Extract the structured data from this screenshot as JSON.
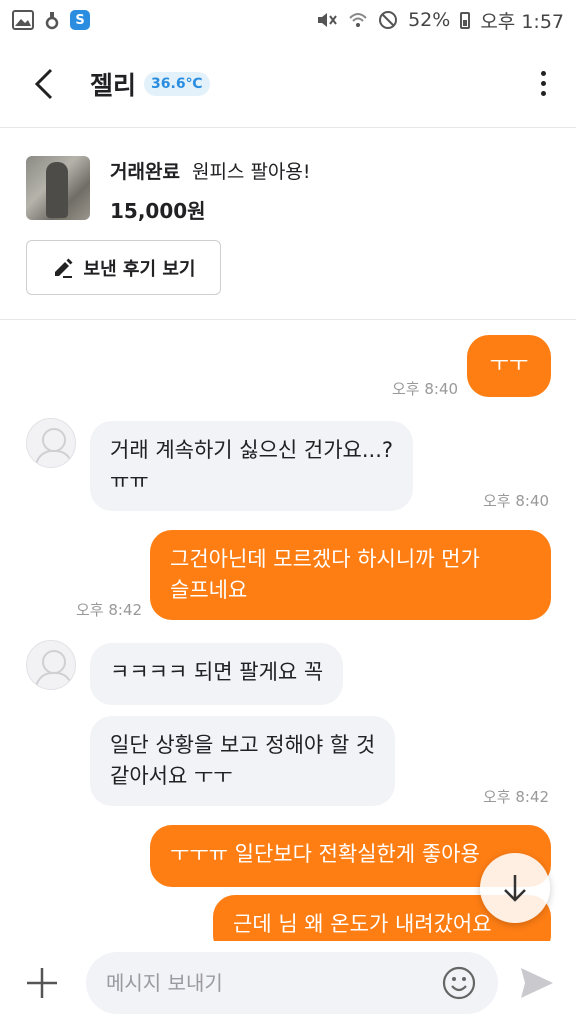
{
  "status_bar": {
    "left_icons": [
      "gallery-icon",
      "handshake-icon",
      "app-s-icon"
    ],
    "app_badge_letter": "S",
    "battery": "52%",
    "time": "오후 1:57"
  },
  "header": {
    "title": "젤리",
    "temperature": "36.6℃",
    "temperature_color": "#2a8de0"
  },
  "product": {
    "status": "거래완료",
    "title": "원피스 팔아용!",
    "price": "15,000원",
    "review_button": "보낸 후기 보기"
  },
  "messages": [
    {
      "sender": "me",
      "text": "ㅜㅜ"
    },
    {
      "sender": "me_time",
      "text": "오후 8:40"
    },
    {
      "sender": "them",
      "text_line1": "거래 계속하기 싫으신 건가요...?",
      "text_line2": "ㅠㅠ"
    },
    {
      "sender": "them_time",
      "text": "오후 8:40"
    },
    {
      "sender": "me",
      "text_line1": "그건아닌데 모르겠다 하시니까 먼가",
      "text_line2": "슬프네요"
    },
    {
      "sender": "me_time",
      "text": "오후 8:42"
    },
    {
      "sender": "them",
      "text": "ㅋㅋㅋㅋ 되면 팔게요 꼭"
    },
    {
      "sender": "them",
      "text_line1": "일단 상황을 보고 정해야 할 것",
      "text_line2": "같아서요 ㅜㅜ"
    },
    {
      "sender": "them_time",
      "text": "오후 8:42"
    },
    {
      "sender": "me",
      "text": "ㅜㅜㅠ 일단보다 전확실한게 좋아용"
    },
    {
      "sender": "me",
      "text": "근데 님 왜 온도가 내려갔어요"
    }
  ],
  "input": {
    "placeholder": "메시지 보내기"
  },
  "colors": {
    "accent": "#ff7e14",
    "other_bubble": "#f2f3f6"
  }
}
